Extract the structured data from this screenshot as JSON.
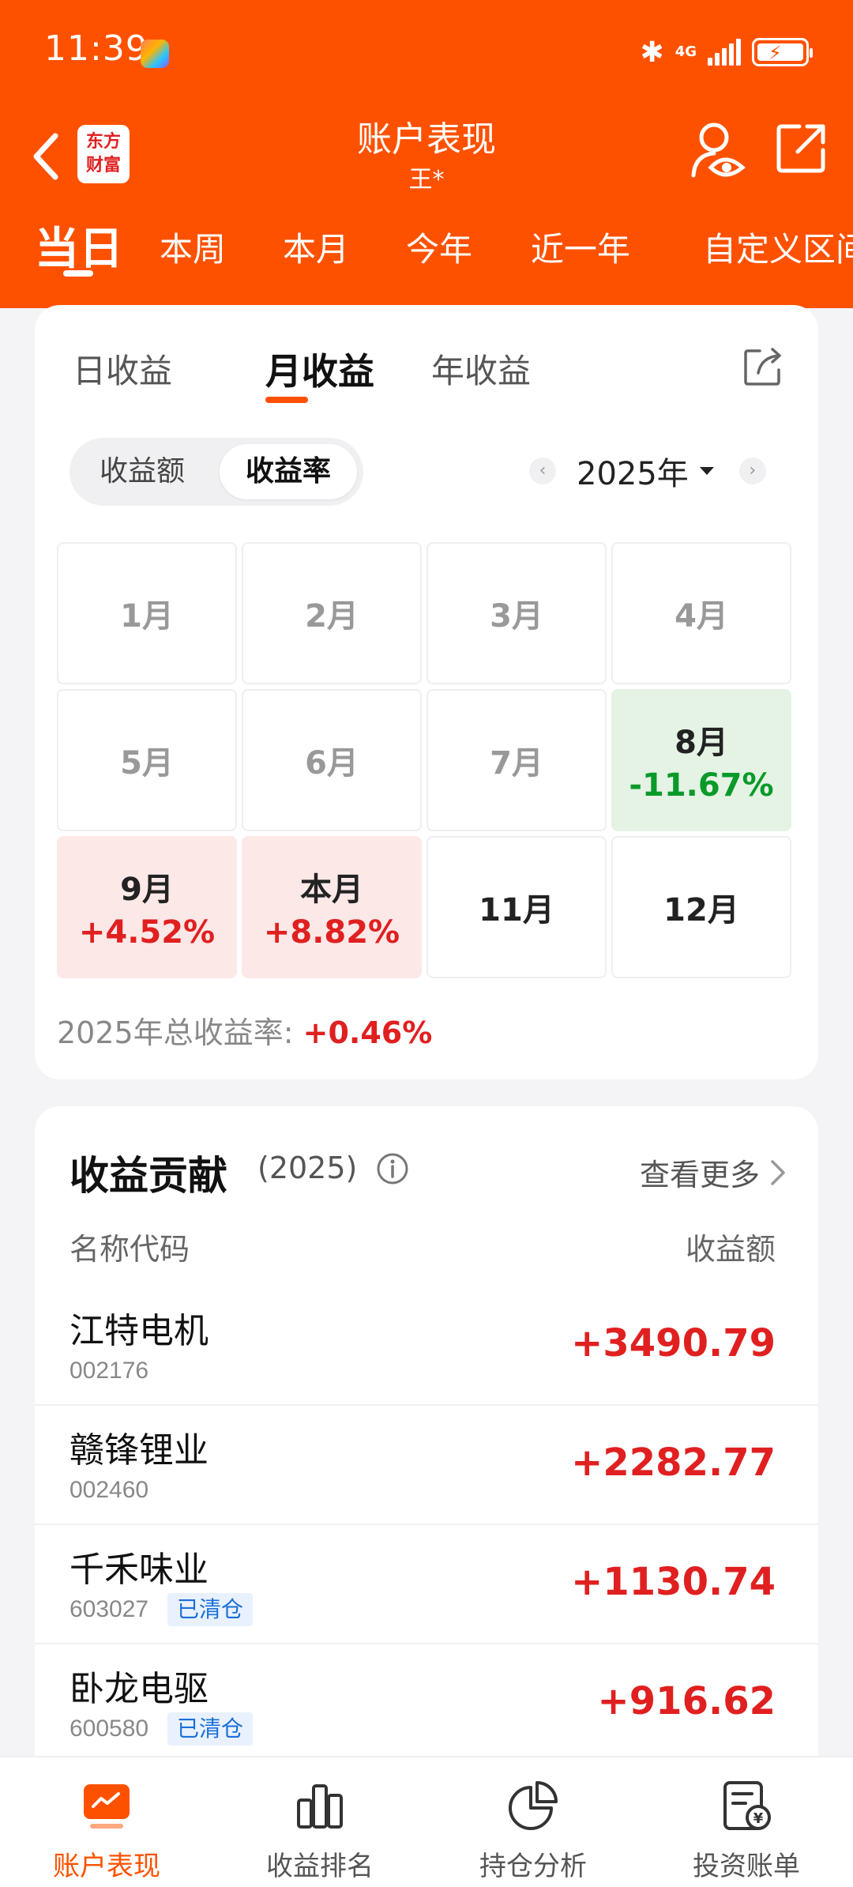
{
  "status_bar": {
    "time": "11:39",
    "network": "4G"
  },
  "nav": {
    "title": "账户表现",
    "subtitle": "王*",
    "logo_top": "东方",
    "logo_bottom": "财富"
  },
  "period_tabs": [
    "当日",
    "本周",
    "本月",
    "今年",
    "近一年",
    "自定义区间"
  ],
  "returns_card": {
    "sub_tabs": [
      "日收益",
      "月收益",
      "年收益"
    ],
    "active_sub_tab": "月收益",
    "toggle": {
      "amount_label": "收益额",
      "rate_label": "收益率",
      "active": "收益率"
    },
    "year": "2025年",
    "months": [
      {
        "label": "1月",
        "value": ""
      },
      {
        "label": "2月",
        "value": ""
      },
      {
        "label": "3月",
        "value": ""
      },
      {
        "label": "4月",
        "value": ""
      },
      {
        "label": "5月",
        "value": ""
      },
      {
        "label": "6月",
        "value": ""
      },
      {
        "label": "7月",
        "value": ""
      },
      {
        "label": "8月",
        "value": "-11.67%"
      },
      {
        "label": "9月",
        "value": "+4.52%"
      },
      {
        "label": "本月",
        "value": "+8.82%"
      },
      {
        "label": "11月",
        "value": ""
      },
      {
        "label": "12月",
        "value": ""
      }
    ],
    "total_label": "2025年总收益率:",
    "total_value": "+0.46%"
  },
  "contribution": {
    "title": "收益贡献",
    "year": "(2025)",
    "more_label": "查看更多",
    "col_name": "名称代码",
    "col_amount": "收益额",
    "rows": [
      {
        "name": "江特电机",
        "code": "002176",
        "tag": "",
        "amount": "+3490.79"
      },
      {
        "name": "赣锋锂业",
        "code": "002460",
        "tag": "",
        "amount": "+2282.77"
      },
      {
        "name": "千禾味业",
        "code": "603027",
        "tag": "已清仓",
        "amount": "+1130.74"
      },
      {
        "name": "卧龙电驱",
        "code": "600580",
        "tag": "已清仓",
        "amount": "+916.62"
      }
    ]
  },
  "bottom_nav": [
    "账户表现",
    "收益排名",
    "持仓分析",
    "投资账单"
  ],
  "colors": {
    "brand": "#fe5100",
    "up": "#e02020",
    "down": "#0a9a2a"
  }
}
